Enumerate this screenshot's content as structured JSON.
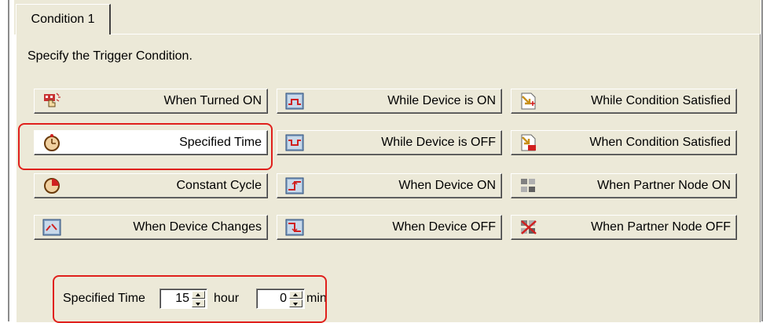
{
  "tab": {
    "label": "Condition 1"
  },
  "prompt": "Specify the Trigger Condition.",
  "buttons": [
    {
      "label": "When Turned ON",
      "icon": "hand-press-icon"
    },
    {
      "label": "While Device is ON",
      "icon": "device-on-icon"
    },
    {
      "label": "While Condition Satisfied",
      "icon": "condition-arrow-icon"
    },
    {
      "label": "Specified Time",
      "icon": "timer-icon",
      "selected": true
    },
    {
      "label": "While Device is OFF",
      "icon": "device-off-icon"
    },
    {
      "label": "When Condition Satisfied",
      "icon": "condition-ok-icon"
    },
    {
      "label": "Constant Cycle",
      "icon": "cycle-icon"
    },
    {
      "label": "When Device ON",
      "icon": "device-rise-icon"
    },
    {
      "label": "When Partner Node ON",
      "icon": "node-on-icon"
    },
    {
      "label": "When Device Changes",
      "icon": "device-change-icon"
    },
    {
      "label": "When Device OFF",
      "icon": "device-fall-icon"
    },
    {
      "label": "When Partner Node OFF",
      "icon": "node-off-icon"
    }
  ],
  "time": {
    "label": "Specified Time",
    "hour_value": "15",
    "hour_unit": "hour",
    "min_value": "0",
    "min_unit": "min"
  },
  "colors": {
    "highlight": "#e0201c",
    "face": "#ece9d8"
  }
}
